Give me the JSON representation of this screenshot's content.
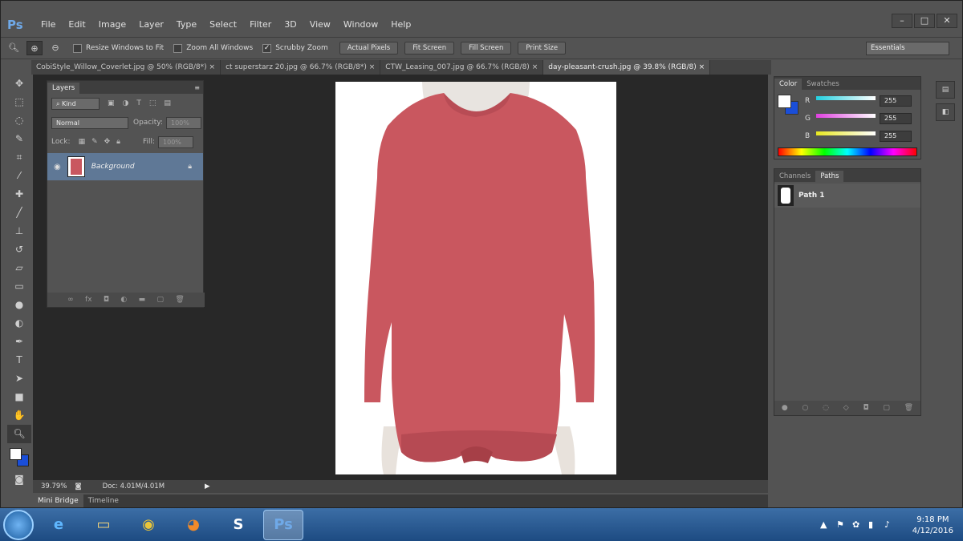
{
  "app": {
    "logo": "Ps",
    "title_icons": [
      "minimize-icon",
      "maximize-icon",
      "close-icon"
    ]
  },
  "menu": [
    "File",
    "Edit",
    "Image",
    "Layer",
    "Type",
    "Select",
    "Filter",
    "3D",
    "View",
    "Window",
    "Help"
  ],
  "options_bar": {
    "resize_windows": "Resize Windows to Fit",
    "zoom_all": "Zoom All Windows",
    "scrubby_zoom": "Scrubby Zoom",
    "buttons": [
      "Actual Pixels",
      "Fit Screen",
      "Fill Screen",
      "Print Size"
    ],
    "workspace": "Essentials"
  },
  "doc_tabs": [
    {
      "label": "CobiStyle_Willow_Coverlet.jpg @ 50% (RGB/8*)",
      "active": false
    },
    {
      "label": "ct superstarz 20.jpg @ 66.7% (RGB/8*)",
      "active": false
    },
    {
      "label": "CTW_Leasing_007.jpg @ 66.7% (RGB/8)",
      "active": false
    },
    {
      "label": "day-pleasant-crush.jpg @ 39.8% (RGB/8)",
      "active": true
    }
  ],
  "layers_panel": {
    "tab": "Layers",
    "filter": "Kind",
    "blend_mode": "Normal",
    "opacity_label": "Opacity:",
    "opacity": "100%",
    "lock_label": "Lock:",
    "fill_label": "Fill:",
    "fill": "100%",
    "layer_name": "Background"
  },
  "status": {
    "zoom": "39.79%",
    "doc": "Doc: 4.01M/4.01M"
  },
  "bottom_tabs": [
    "Mini Bridge",
    "Timeline"
  ],
  "color_panel": {
    "tabs": [
      "Color",
      "Swatches"
    ],
    "channels": [
      {
        "label": "R",
        "value": "255",
        "color": "#23d0e0"
      },
      {
        "label": "G",
        "value": "255",
        "color": "#e040e0"
      },
      {
        "label": "B",
        "value": "255",
        "color": "#e8e820"
      }
    ]
  },
  "paths_panel": {
    "tabs": [
      "Channels",
      "Paths"
    ],
    "path_name": "Path 1"
  },
  "taskbar": {
    "time": "9:18 PM",
    "date": "4/12/2016"
  },
  "colors": {
    "sweater": "#c9575f",
    "ui_dark": "#535353",
    "canvas_bg": "#282828"
  }
}
